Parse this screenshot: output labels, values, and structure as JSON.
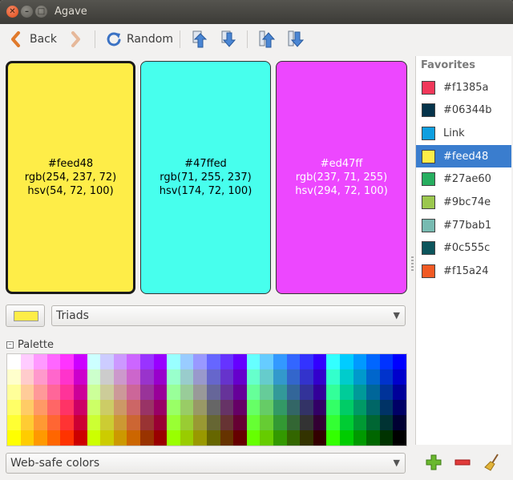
{
  "window": {
    "title": "Agave"
  },
  "toolbar": {
    "back_label": "Back",
    "random_label": "Random"
  },
  "swatches": [
    {
      "hex": "#feed48",
      "rgb": "rgb(254, 237, 72)",
      "hsv": "hsv(54, 72, 100)",
      "color": "#feed48",
      "text_color": "#000000"
    },
    {
      "hex": "#47ffed",
      "rgb": "rgb(71, 255, 237)",
      "hsv": "hsv(174, 72, 100)",
      "color": "#47ffed",
      "text_color": "#000000"
    },
    {
      "hex": "#ed47ff",
      "rgb": "rgb(237, 71, 255)",
      "hsv": "hsv(294, 72, 100)",
      "color": "#ed47ff",
      "text_color": "#ffffff"
    }
  ],
  "controls": {
    "current_color": "#feed48",
    "scheme_value": "Triads"
  },
  "palette": {
    "label": "Palette",
    "set_value": "Web-safe colors"
  },
  "favorites": {
    "header": "Favorites",
    "items": [
      {
        "label": "#f1385a",
        "color": "#f1385a"
      },
      {
        "label": "#06344b",
        "color": "#06344b"
      },
      {
        "label": "Link",
        "color": "#0f9fe0"
      },
      {
        "label": "#feed48",
        "color": "#feed48",
        "selected": true
      },
      {
        "label": "#27ae60",
        "color": "#27ae60"
      },
      {
        "label": "#9bc74e",
        "color": "#9bc74e"
      },
      {
        "label": "#77bab1",
        "color": "#77bab1"
      },
      {
        "label": "#0c555c",
        "color": "#0c555c"
      },
      {
        "label": "#f15a24",
        "color": "#f15a24"
      }
    ]
  }
}
